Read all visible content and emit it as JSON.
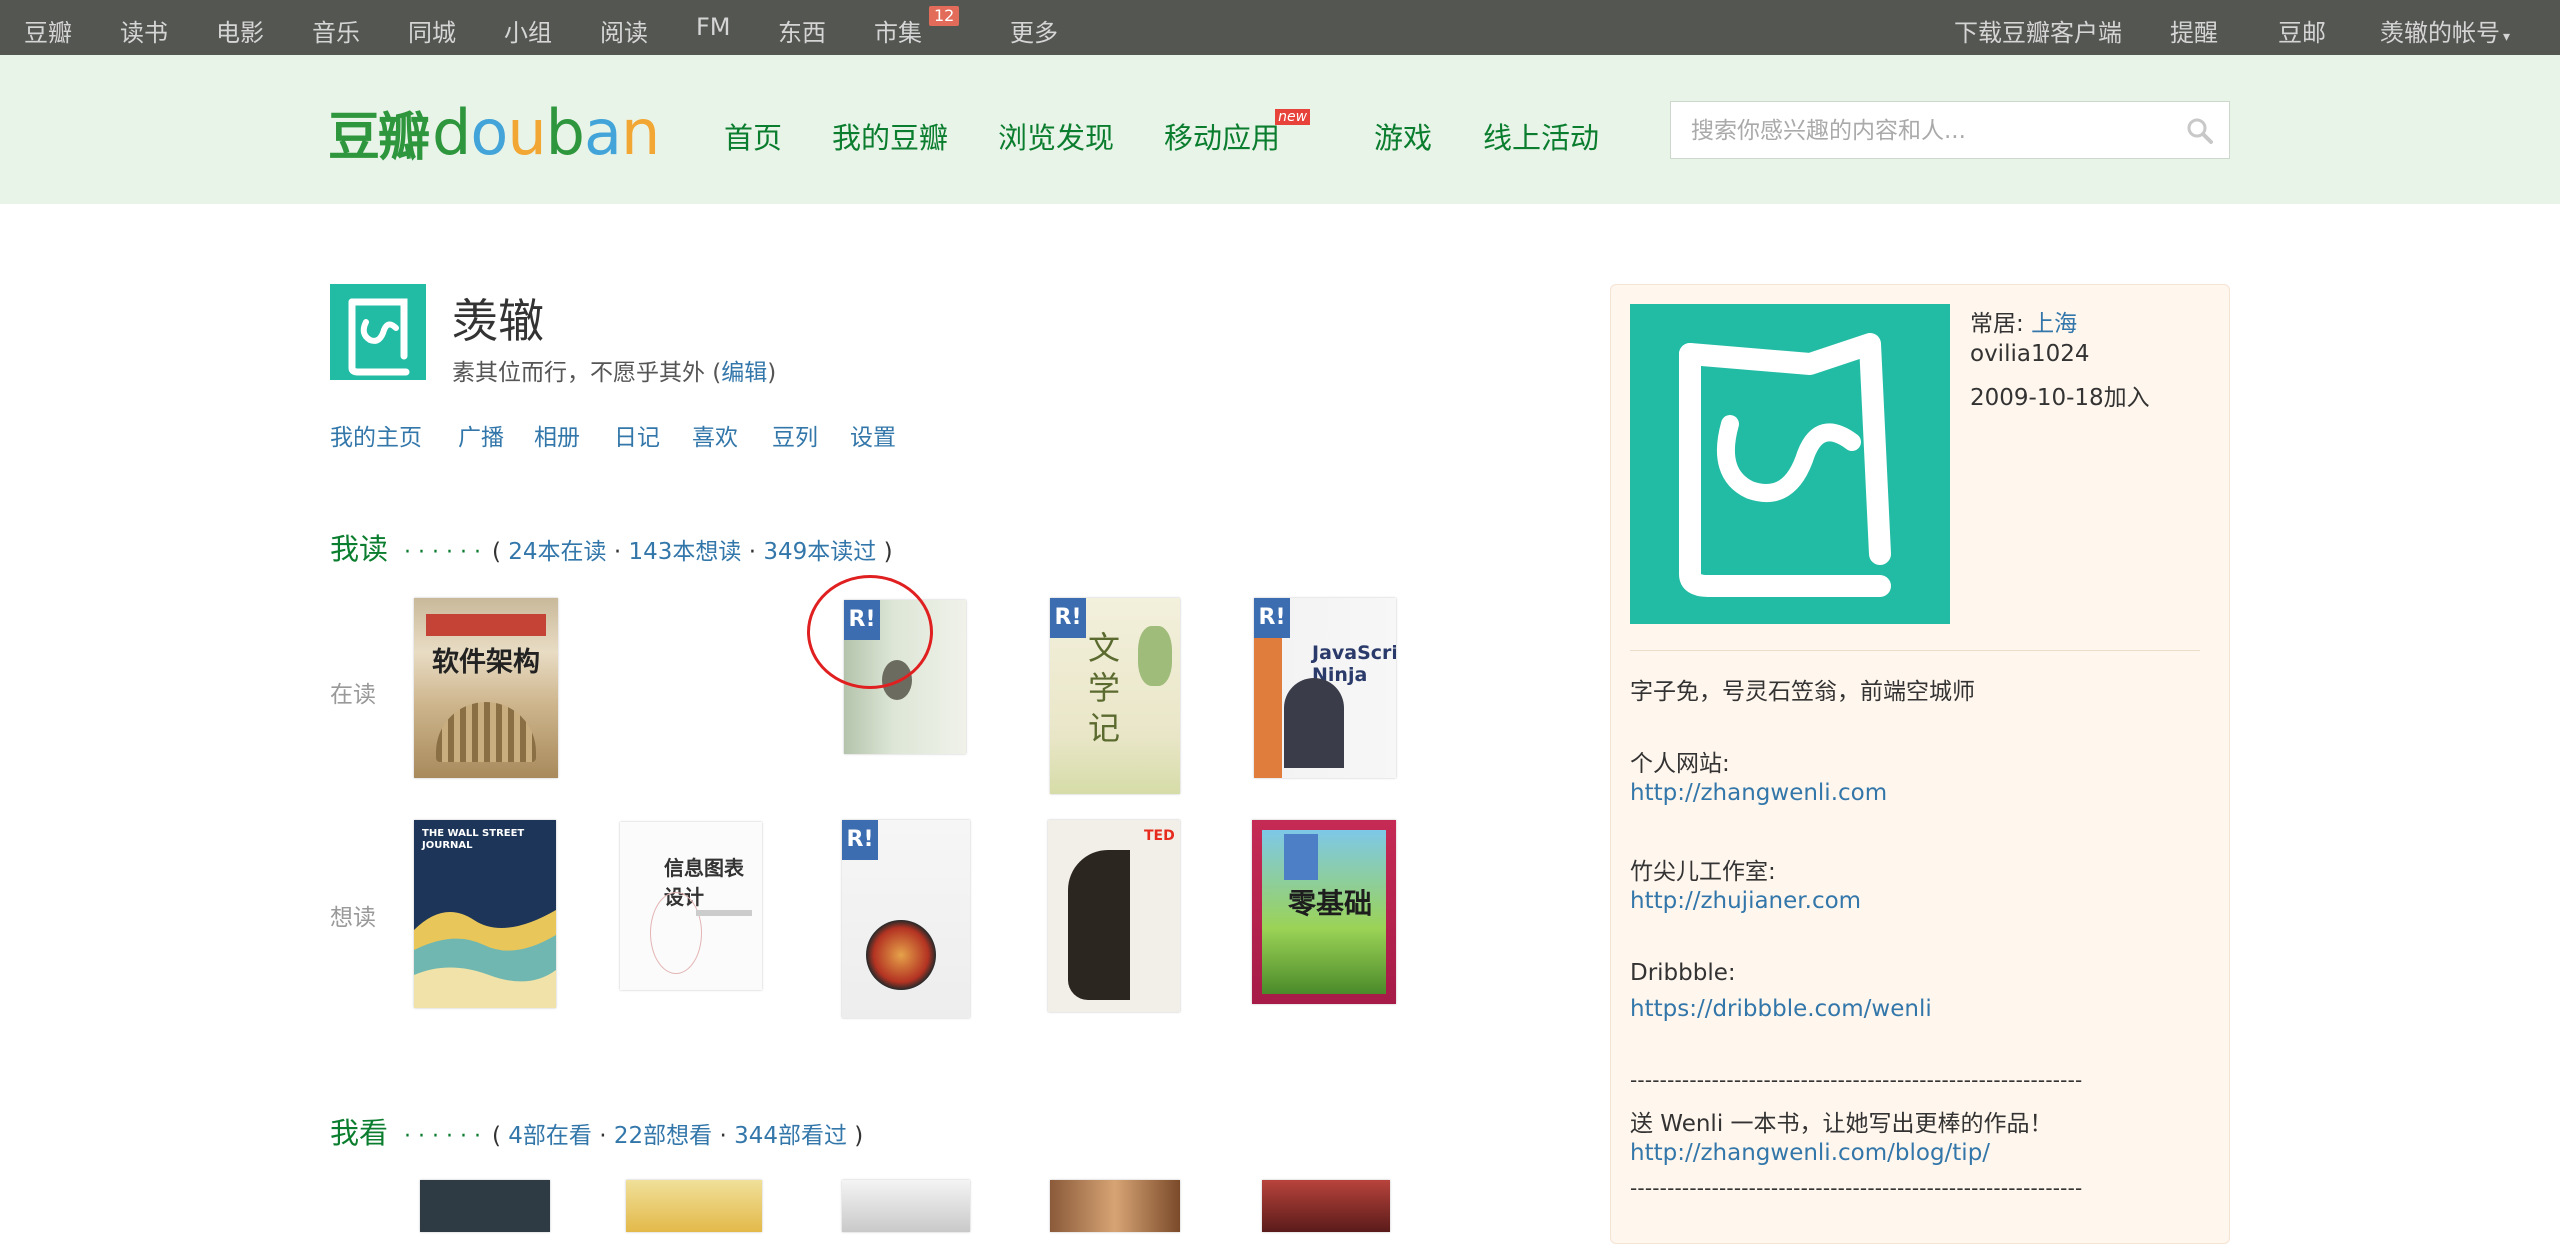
{
  "topnav": {
    "items": [
      "豆瓣",
      "读书",
      "电影",
      "音乐",
      "同城",
      "小组",
      "阅读",
      "FM",
      "东西",
      "市集",
      "更多"
    ],
    "market_badge": "12",
    "right": [
      "下载豆瓣客户端",
      "提醒",
      "豆邮",
      "羡辙的帐号"
    ]
  },
  "header": {
    "logo_cn": "豆瓣",
    "logo_en": [
      "d",
      "o",
      "u",
      "b",
      "a",
      "n"
    ],
    "logo_colors": [
      "#2e963d",
      "#42a4d8",
      "#f2a633",
      "#2e963d",
      "#42a4d8",
      "#f2a633"
    ],
    "nav": [
      "首页",
      "我的豆瓣",
      "浏览发现",
      "移动应用",
      "游戏",
      "线上活动"
    ],
    "new_badge": "new",
    "search_placeholder": "搜索你感兴趣的内容和人..."
  },
  "profile": {
    "name": "羡辙",
    "signature": "素其位而行，不愿乎其外 (",
    "edit_label": "编辑",
    "signature_end": ")",
    "nav": [
      "我的主页",
      "广播",
      "相册",
      "日记",
      "喜欢",
      "豆列",
      "设置"
    ]
  },
  "reading": {
    "heading": "我读",
    "dots": "······",
    "open_paren": "(",
    "reading_link": "24本在读",
    "sep1": "·",
    "wish_link": "143本想读",
    "sep2": "·",
    "read_link": "349本读过",
    "close_paren": ")",
    "label_reading": "在读",
    "label_wish": "想读",
    "badge": "R!",
    "books_reading": [
      {
        "title": "软件架构"
      },
      {
        "title": ""
      },
      {
        "title": "文学记"
      },
      {
        "title": "JavaScript Ninja"
      }
    ],
    "books_wish": [
      {
        "title": "THE WALL STREET JOURNAL"
      },
      {
        "title": "信息图表设计"
      },
      {
        "title": ""
      },
      {
        "title": "TED"
      },
      {
        "title": "零基础"
      }
    ]
  },
  "movies": {
    "heading": "我看",
    "dots": "······",
    "open_paren": "(",
    "watching_link": "4部在看",
    "sep1": "·",
    "wish_link": "22部想看",
    "sep2": "·",
    "watched_link": "344部看过",
    "close_paren": ")"
  },
  "side": {
    "location_label": "常居:",
    "location": "上海",
    "user_id": "ovilia1024",
    "joined": "2009-10-18加入",
    "bio": "字子免，号灵石笠翁，前端空城师",
    "website_label": "个人网站:",
    "website": "http://zhangwenli.com",
    "studio_label": "竹尖儿工作室:",
    "studio": "http://zhujianer.com",
    "dribbble_label": "Dribbble:",
    "dribbble": "https://dribbble.com/wenli",
    "divider": "-------------------------------------------------------------",
    "gift_text": "送 Wenli 一本书，让她写出更棒的作品！",
    "gift_link": "http://zhangwenli.com/blog/tip/"
  }
}
